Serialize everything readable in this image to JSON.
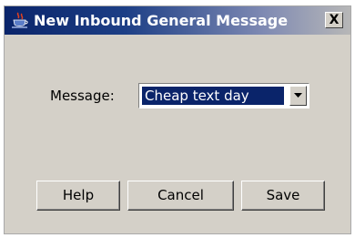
{
  "window": {
    "title": "New Inbound General Message",
    "close_label": "X",
    "icon": "java-cup-icon"
  },
  "form": {
    "message_label": "Message:",
    "message_value": "Cheap text day"
  },
  "buttons": {
    "help": "Help",
    "cancel": "Cancel",
    "save": "Save"
  },
  "colors": {
    "titlebar_active": "#0a246a",
    "selection": "#0a246a",
    "dialog_face": "#d4d0c8"
  }
}
